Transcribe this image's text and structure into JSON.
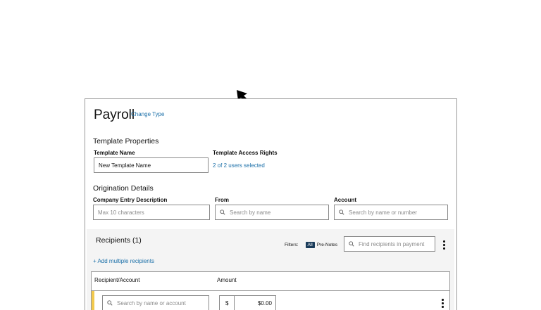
{
  "header": {
    "title": "Payroll",
    "change_type_label": "Change Type"
  },
  "template_properties": {
    "heading": "Template Properties",
    "name_label": "Template Name",
    "name_value": "New Template Name",
    "access_label": "Template Access Rights",
    "access_link": "2 of 2 users selected"
  },
  "origination": {
    "heading": "Origination Details",
    "company_label": "Company Entry Description",
    "company_placeholder": "Max 10 characters",
    "from_label": "From",
    "from_placeholder": "Search by name",
    "account_label": "Account",
    "account_placeholder": "Search by name or number"
  },
  "recipients": {
    "heading": "Recipients (1)",
    "filters_label": "Filters:",
    "filter_all": "All",
    "filter_prenotes": "Pre-Notes",
    "find_placeholder": "Find recipients in payment",
    "add_multiple": "+ Add multiple recipients",
    "col_recipient": "Recipient/Account",
    "col_amount": "Amount",
    "row_search_placeholder": "Search by name or account",
    "currency_symbol": "$",
    "amount_value": "$0.00"
  },
  "colors": {
    "link": "#1a6fa8",
    "chip_active": "#1a3b5a",
    "row_marker": "#f2c94c"
  },
  "icons": [
    "cursor-arrow-icon",
    "search-icon",
    "kebab-menu-icon"
  ]
}
